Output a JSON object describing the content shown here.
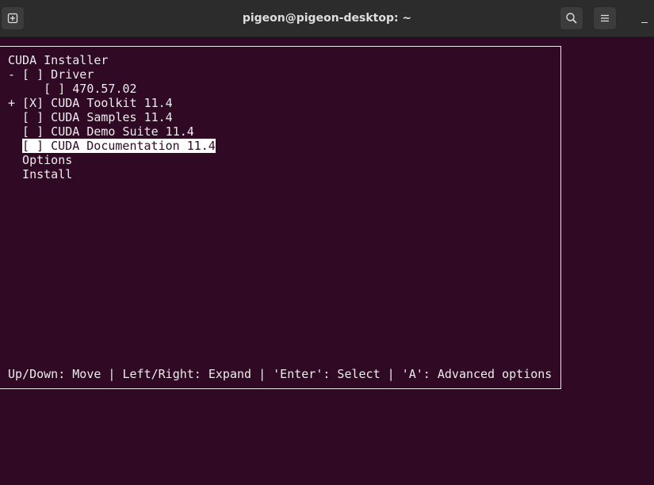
{
  "window": {
    "title": "pigeon@pigeon-desktop: ~",
    "new_tab_icon": "new-tab-icon",
    "search_icon": "search-icon",
    "menu_icon": "hamburger-menu-icon",
    "minimize_icon": "minimize-icon"
  },
  "installer": {
    "heading": "CUDA Installer",
    "items": [
      {
        "text": "- [ ] Driver",
        "selected": false
      },
      {
        "text": "     [ ] 470.57.02",
        "selected": false
      },
      {
        "text": "+ [X] CUDA Toolkit 11.4",
        "selected": false
      },
      {
        "text": "  [ ] CUDA Samples 11.4",
        "selected": false
      },
      {
        "text": "  [ ] CUDA Demo Suite 11.4",
        "selected": false
      },
      {
        "text": "[ ] CUDA Documentation 11.4",
        "selected": true
      },
      {
        "text": "  Options",
        "selected": false
      },
      {
        "text": "  Install",
        "selected": false
      }
    ],
    "help": "Up/Down: Move | Left/Right: Expand | 'Enter': Select | 'A': Advanced options"
  },
  "colors": {
    "terminal_bg": "#300a24",
    "terminal_fg": "#ececec",
    "highlight_bg": "#ffffff",
    "titlebar_bg": "#2c2c2c"
  }
}
